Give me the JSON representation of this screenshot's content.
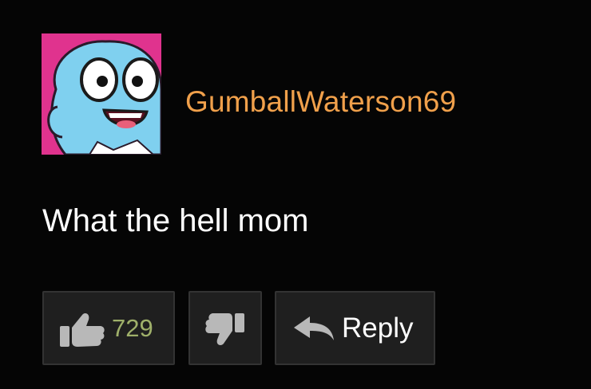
{
  "comment": {
    "username": "GumballWaterson69",
    "text": "What the hell mom",
    "likes": "729",
    "reply_label": "Reply",
    "avatar_icon": "gumball-avatar-icon"
  },
  "colors": {
    "background": "#050505",
    "username": "#f0a04b",
    "like_count": "#9fb06a",
    "button_bg": "#1f1f1f",
    "button_border": "#333333",
    "icon": "#b8b8b8",
    "avatar_bg": "#e0338e",
    "avatar_face": "#7fd0ef"
  },
  "icons": {
    "like": "thumbs-up-icon",
    "dislike": "thumbs-down-icon",
    "reply": "reply-arrow-icon"
  }
}
